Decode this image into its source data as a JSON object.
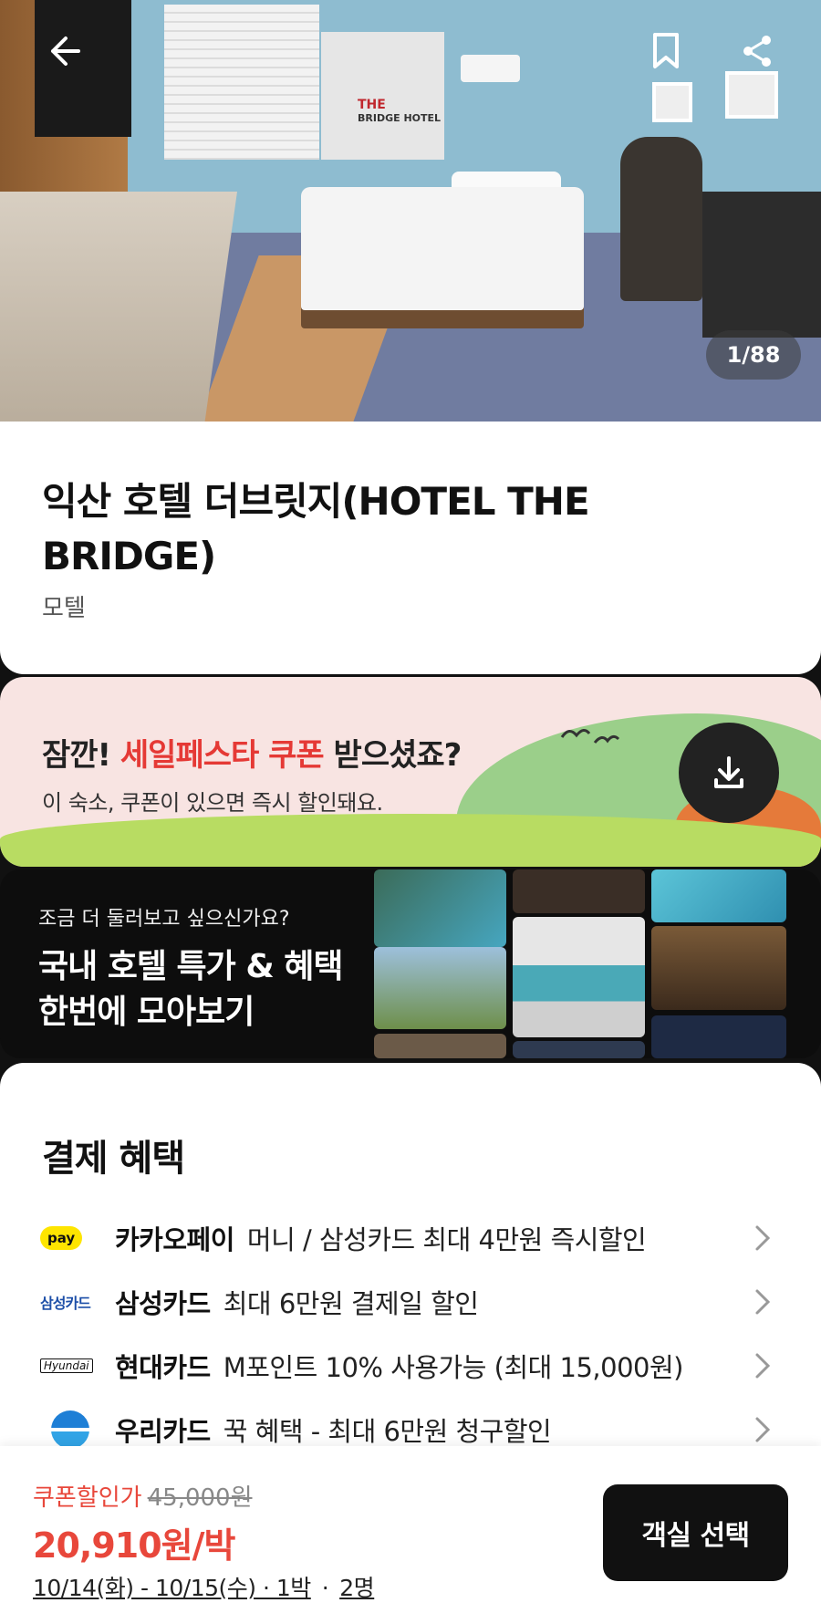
{
  "hero": {
    "counter": "1/88",
    "back_icon": "arrow-left-icon",
    "bookmark_icon": "bookmark-icon",
    "share_icon": "share-icon",
    "sign_text_1": "THE",
    "sign_text_2": "BRIDGE HOTEL"
  },
  "property": {
    "title": "익산 호텔 더브릿지(HOTEL THE BRIDGE)",
    "category": "모텔"
  },
  "coupon_banner": {
    "headline_prefix": "잠깐! ",
    "headline_highlight": "세일페스타 쿠폰",
    "headline_suffix": " 받으셨죠?",
    "subtext": "이 숙소, 쿠폰이 있으면 즉시 할인돼요.",
    "download_icon": "download-icon",
    "accent_color": "#e53935"
  },
  "promo_banner": {
    "subtitle": "조금 더 둘러보고 싶으신가요?",
    "title_line1": "국내 호텔 특가 & 혜택",
    "title_line2": "한번에 모아보기"
  },
  "benefits": {
    "heading": "결제 혜택",
    "items": [
      {
        "logo": "pay",
        "name": "카카오페이",
        "desc": "머니 / 삼성카드 최대 4만원 즉시할인"
      },
      {
        "logo": "삼성카드",
        "name": "삼성카드",
        "desc": "최대 6만원 결제일 할인"
      },
      {
        "logo": "Hyundai",
        "name": "현대카드",
        "desc": "M포인트 10% 사용가능 (최대 15,000원)"
      },
      {
        "logo": "woori",
        "name": "우리카드",
        "desc": "꾹 혜택 - 최대 6만원 청구할인"
      }
    ]
  },
  "bottom_bar": {
    "coupon_label": "쿠폰할인가",
    "original_price": "45,000원",
    "price": "20,910원/박",
    "dates": "10/14(화) - 10/15(수) · 1박",
    "separator": "·",
    "guests": "2명",
    "select_button": "객실 선택",
    "price_color": "#e8473b"
  }
}
